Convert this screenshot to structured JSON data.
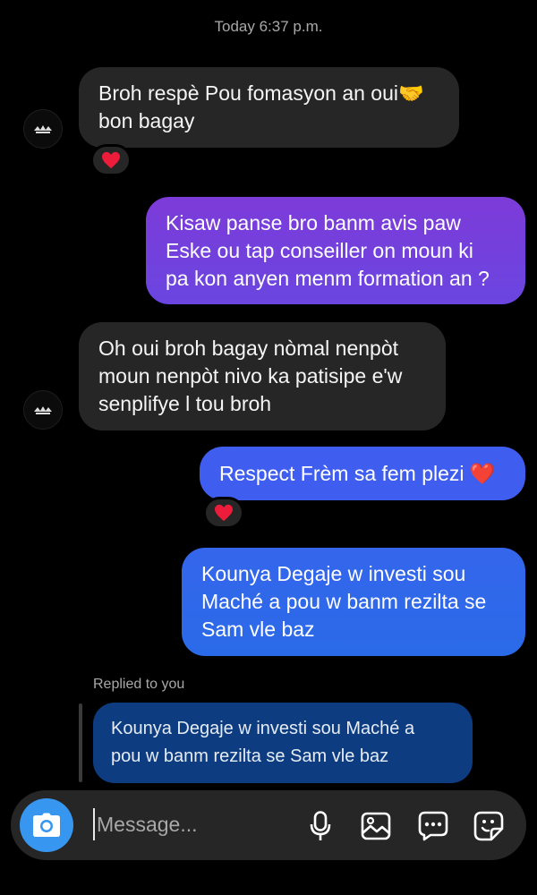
{
  "thread": {
    "timestamp": "Today 6:37 p.m."
  },
  "messages": [
    {
      "from": "them",
      "lines": [
        "Broh respè Pou fomasyon an oui🤝",
        "bon bagay"
      ],
      "reaction": "❤️"
    },
    {
      "from": "me",
      "lines": [
        "Kisaw panse bro banm avis paw",
        "Eske ou tap conseiller on moun ki",
        "pa kon anyen menm formation an ?"
      ]
    },
    {
      "from": "them",
      "lines": [
        "Oh oui broh bagay nòmal nenpòt",
        "moun nenpòt nivo ka patisipe e'w",
        "senplifye l tou broh"
      ]
    },
    {
      "from": "me",
      "lines": [
        "Respect Frèm sa fem plezi ❤️"
      ],
      "reaction": "❤️"
    },
    {
      "from": "me",
      "lines": [
        "Kounya Degaje w investi sou",
        "Maché a pou w banm rezilta se",
        "Sam vle baz"
      ]
    }
  ],
  "reply": {
    "label": "Replied to you",
    "lines": [
      "Kounya Degaje w investi sou Maché a",
      "pou w banm rezilta se Sam vle baz"
    ]
  },
  "composer": {
    "placeholder": "Message...",
    "icons": [
      "camera-icon",
      "microphone-icon",
      "gallery-icon",
      "chat-options-icon",
      "sticker-icon"
    ]
  },
  "colors": {
    "background": "#000000",
    "incoming_bubble": "#262626",
    "outgoing_top": "#7d3bd9",
    "outgoing_mid": "#3f5ef0",
    "outgoing_bottom": "#2a6ae8",
    "camera_button": "#3797f0",
    "heart": "#ed1c3a"
  }
}
